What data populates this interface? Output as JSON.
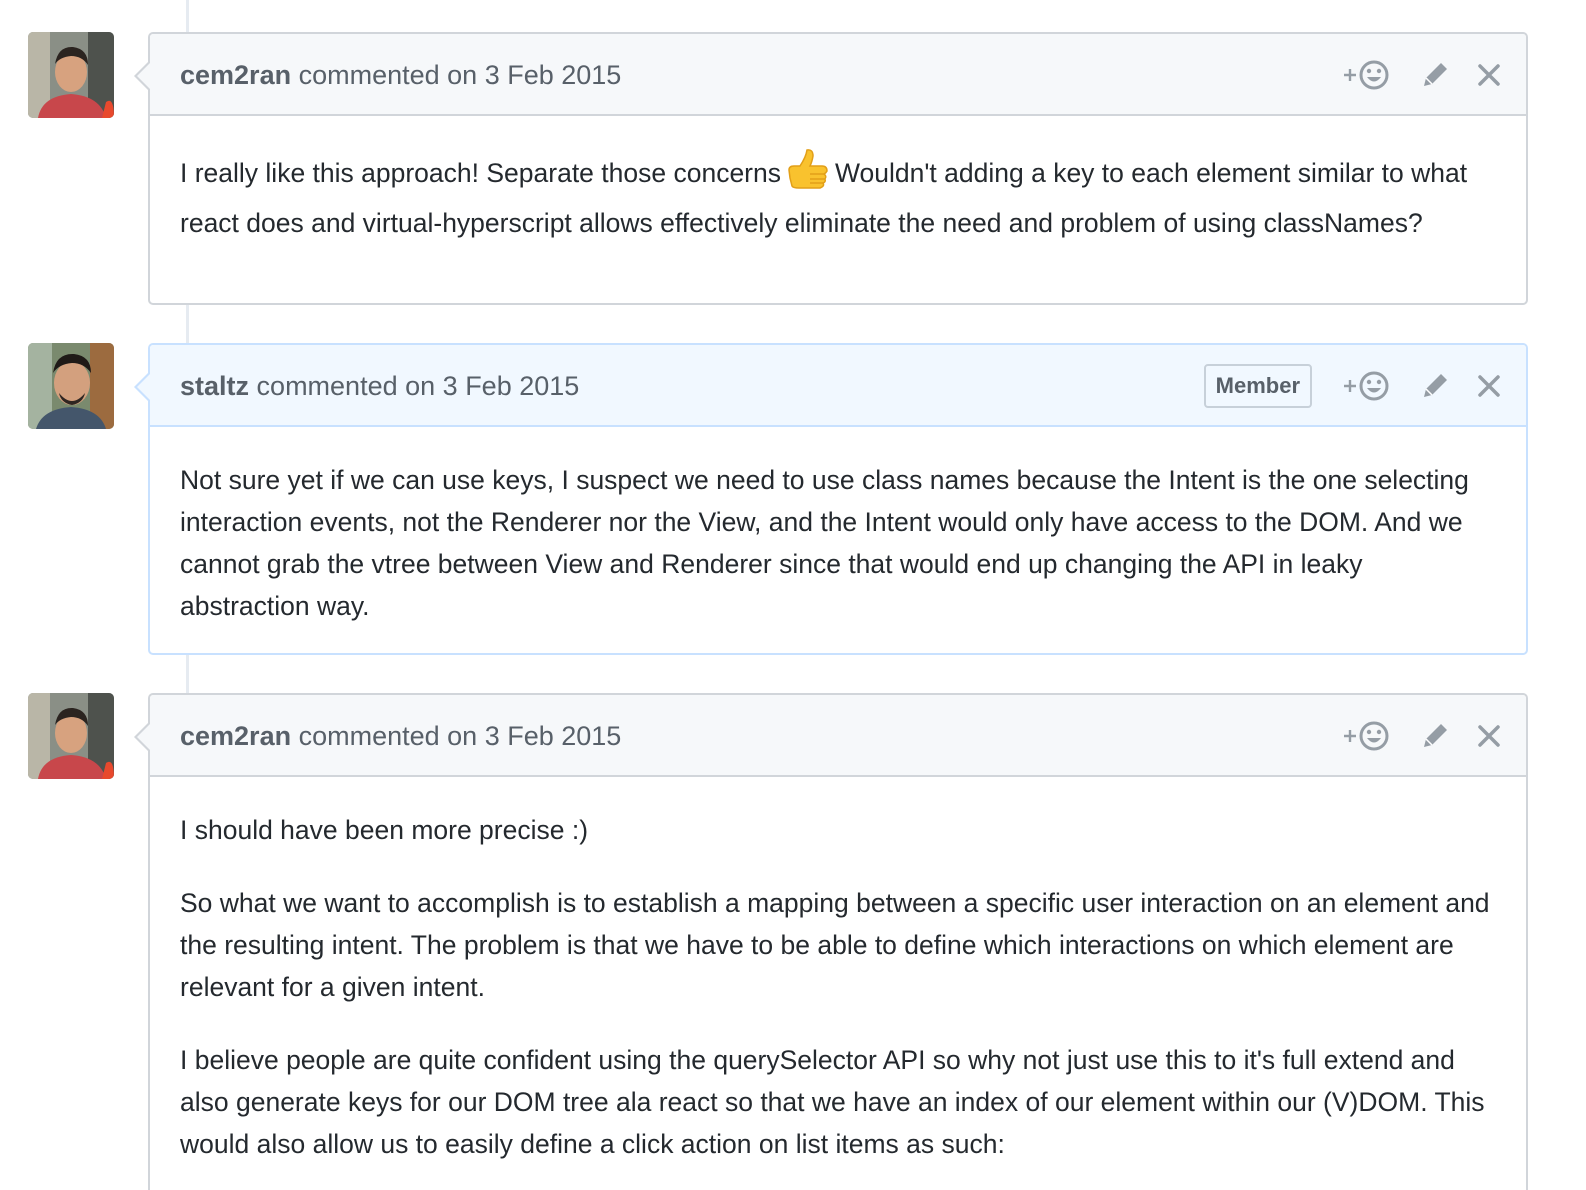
{
  "comments": [
    {
      "author": "cem2ran",
      "action_text": "commented on",
      "date": "3 Feb 2015",
      "badge": "",
      "body": {
        "p1_before_emoji": "I really like this approach! Separate those concerns",
        "emoji": "thumbsup",
        "p1_after_emoji": "Wouldn't adding a key to each element similar to what react does and virtual-hyperscript allows effectively eliminate the need and problem of using classNames?"
      }
    },
    {
      "author": "staltz",
      "action_text": "commented on",
      "date": "3 Feb 2015",
      "badge": "Member",
      "body": {
        "p1": "Not sure yet if we can use keys, I suspect we need to use class names because the Intent is the one selecting interaction events, not the Renderer nor the View, and the Intent would only have access to the DOM. And we cannot grab the vtree between View and Renderer since that would end up changing the API in leaky abstraction way."
      }
    },
    {
      "author": "cem2ran",
      "action_text": "commented on",
      "date": "3 Feb 2015",
      "badge": "",
      "body": {
        "p1": "I should have been more precise :)",
        "p2": "So what we want to accomplish is to establish a mapping between a specific user interaction on an element and the resulting intent. The problem is that we have to be able to define which interactions on which element are relevant for a given intent.",
        "p3": "I believe people are quite confident using the querySelector API so why not just use this to it's full extend and also generate keys for our DOM tree ala react so that we have an index of our element within our (V)DOM. This would also allow us to easily define a click action on list items as such:"
      }
    }
  ],
  "icons": {
    "reaction": "add-reaction-smiley-icon",
    "edit": "pencil-icon",
    "delete": "close-x-icon"
  },
  "colors": {
    "header_bg": "#f6f8fa",
    "member_header_bg": "#f1f8ff",
    "border": "#d1d5da",
    "member_border": "#c8e1ff",
    "muted_text": "#586069",
    "body_text": "#24292e"
  }
}
